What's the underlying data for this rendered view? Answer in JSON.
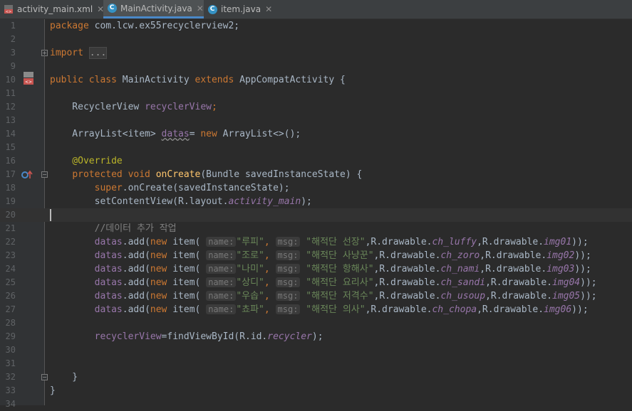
{
  "tabs": [
    {
      "label": "activity_main.xml",
      "icon": "xml-file-icon"
    },
    {
      "label": "MainActivity.java",
      "icon": "java-class-icon",
      "active": true
    },
    {
      "label": "item.java",
      "icon": "java-class-icon"
    }
  ],
  "line_numbers": [
    "1",
    "2",
    "3",
    "9",
    "10",
    "11",
    "12",
    "13",
    "14",
    "15",
    "16",
    "17",
    "18",
    "19",
    "20",
    "21",
    "22",
    "23",
    "24",
    "25",
    "26",
    "27",
    "28",
    "29",
    "30",
    "31",
    "32",
    "33",
    "34"
  ],
  "code": {
    "l1_kw": "package",
    "l1_rest": " com.lcw.ex55recyclerview2;",
    "l3_kw": "import",
    "l3_folded": "...",
    "l10_kw1": "public class",
    "l10_name": " MainActivity ",
    "l10_kw2": "extends",
    "l10_rest": " AppCompatActivity {",
    "l12_type": "    RecyclerView ",
    "l12_field": "recyclerView",
    "l12_end": ";",
    "l14_type": "    ArrayList<item> ",
    "l14_field": "datas",
    "l14_eq": "= ",
    "l14_kw": "new",
    "l14_end": " ArrayList<>();",
    "l16_ann": "    @Override",
    "l17_indent": "    ",
    "l17_kw": "protected void",
    "l17_sp": " ",
    "l17_method": "onCreate",
    "l17_rest": "(Bundle savedInstanceState) {",
    "l18_indent": "        ",
    "l18_kw": "super",
    "l18_rest": ".onCreate(savedInstanceState);",
    "l19_a": "        setContentView(R.layout.",
    "l19_b": "activity_main",
    "l19_c": ");",
    "l21_comment": "        //데이터 추가 작업",
    "data_lines": [
      {
        "name": "\"루피\"",
        "msg": "\"해적단 선장\"",
        "ch": "ch_luffy",
        "img": "img01"
      },
      {
        "name": "\"조로\"",
        "msg": "\"해적단 사냥꾼\"",
        "ch": "ch_zoro",
        "img": "img02"
      },
      {
        "name": "\"나미\"",
        "msg": "\"해적단 항해사\"",
        "ch": "ch_nami",
        "img": "img03"
      },
      {
        "name": "\"상디\"",
        "msg": "\"해적단 요리사\"",
        "ch": "ch_sandi",
        "img": "img04"
      },
      {
        "name": "\"우솝\"",
        "msg": "\"해적단 저격수\"",
        "ch": "ch_usoup",
        "img": "img05"
      },
      {
        "name": "\"쵸파\"",
        "msg": "\"해적단 의사\"",
        "ch": "ch_chopa",
        "img": "img06"
      }
    ],
    "dl_indent": "        ",
    "dl_field": "datas",
    "dl_add": ".add(",
    "dl_new": "new",
    "dl_item": " item(",
    "dl_name_hint": "name:",
    "dl_msg_hint": "msg:",
    "dl_comma": ",",
    "dl_drawable": ",R.drawable.",
    "dl_end": "));",
    "l29_indent": "        ",
    "l29_field": "recyclerView",
    "l29_mid": "=findViewById(R.id.",
    "l29_id": "recycler",
    "l29_end": ");",
    "l32": "    }",
    "l33": "}"
  }
}
